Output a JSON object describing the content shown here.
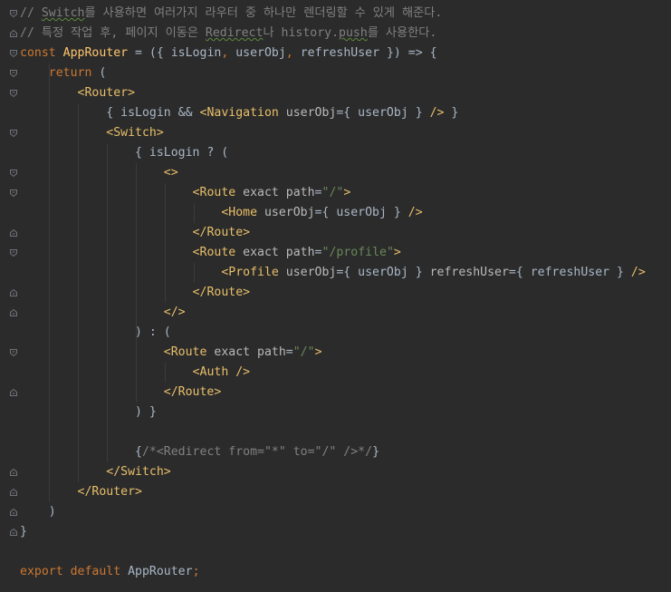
{
  "editor": {
    "background": "#2b2b2b",
    "colors": {
      "keyword": "#cc7832",
      "tag": "#e8bf6a",
      "attribute": "#bababa",
      "string": "#6a8759",
      "comment": "#808080",
      "function": "#ffc66d",
      "text": "#a9b7c6"
    },
    "lines": [
      {
        "tokens": [
          {
            "type": "c",
            "text": "// "
          },
          {
            "type": "c",
            "text": "Switch",
            "squiggle": true
          },
          {
            "type": "c",
            "text": "를 사용하면 여러가지 라우터 중 하나만 렌더링할 수 있게 해준다."
          }
        ]
      },
      {
        "tokens": [
          {
            "type": "c",
            "text": "// 특정 작업 후, 페이지 이동은 "
          },
          {
            "type": "c",
            "text": "Redirect",
            "squiggle": true
          },
          {
            "type": "c",
            "text": "나 history."
          },
          {
            "type": "c",
            "text": "push",
            "squiggle": true
          },
          {
            "type": "c",
            "text": "를 사용한다."
          }
        ]
      },
      {
        "tokens": [
          {
            "type": "k",
            "text": "const "
          },
          {
            "type": "f",
            "text": "AppRouter"
          },
          {
            "type": "p",
            "text": " = ({ isLogin"
          },
          {
            "type": "k",
            "text": ", "
          },
          {
            "type": "p",
            "text": "userObj"
          },
          {
            "type": "k",
            "text": ", "
          },
          {
            "type": "p",
            "text": "refreshUser }) => {"
          }
        ]
      },
      {
        "tokens": [
          {
            "type": "p",
            "text": "    "
          },
          {
            "type": "k",
            "text": "return "
          },
          {
            "type": "p",
            "text": "("
          }
        ]
      },
      {
        "tokens": [
          {
            "type": "p",
            "text": "        "
          },
          {
            "type": "t",
            "text": "<Router>"
          }
        ]
      },
      {
        "tokens": [
          {
            "type": "p",
            "text": "            { isLogin && "
          },
          {
            "type": "t",
            "text": "<Navigation "
          },
          {
            "type": "a",
            "text": "userObj"
          },
          {
            "type": "p",
            "text": "={ userObj } "
          },
          {
            "type": "t",
            "text": "/>"
          },
          {
            "type": "p",
            "text": " }"
          }
        ]
      },
      {
        "tokens": [
          {
            "type": "p",
            "text": "            "
          },
          {
            "type": "t",
            "text": "<Switch>"
          }
        ]
      },
      {
        "tokens": [
          {
            "type": "p",
            "text": "                { isLogin ? ("
          }
        ]
      },
      {
        "tokens": [
          {
            "type": "p",
            "text": "                    "
          },
          {
            "type": "t",
            "text": "<>"
          }
        ]
      },
      {
        "tokens": [
          {
            "type": "p",
            "text": "                        "
          },
          {
            "type": "t",
            "text": "<Route "
          },
          {
            "type": "a",
            "text": "exact path"
          },
          {
            "type": "p",
            "text": "="
          },
          {
            "type": "s",
            "text": "\"/\""
          },
          {
            "type": "t",
            "text": ">"
          }
        ]
      },
      {
        "tokens": [
          {
            "type": "p",
            "text": "                            "
          },
          {
            "type": "t",
            "text": "<Home "
          },
          {
            "type": "a",
            "text": "userObj"
          },
          {
            "type": "p",
            "text": "={ userObj } "
          },
          {
            "type": "t",
            "text": "/>"
          }
        ]
      },
      {
        "tokens": [
          {
            "type": "p",
            "text": "                        "
          },
          {
            "type": "t",
            "text": "</Route>"
          }
        ]
      },
      {
        "tokens": [
          {
            "type": "p",
            "text": "                        "
          },
          {
            "type": "t",
            "text": "<Route "
          },
          {
            "type": "a",
            "text": "exact path"
          },
          {
            "type": "p",
            "text": "="
          },
          {
            "type": "s",
            "text": "\"/profile\""
          },
          {
            "type": "t",
            "text": ">"
          }
        ]
      },
      {
        "tokens": [
          {
            "type": "p",
            "text": "                            "
          },
          {
            "type": "t",
            "text": "<Profile "
          },
          {
            "type": "a",
            "text": "userObj"
          },
          {
            "type": "p",
            "text": "={ userObj } "
          },
          {
            "type": "a",
            "text": "refreshUser"
          },
          {
            "type": "p",
            "text": "={ refreshUser } "
          },
          {
            "type": "t",
            "text": "/>"
          }
        ]
      },
      {
        "tokens": [
          {
            "type": "p",
            "text": "                        "
          },
          {
            "type": "t",
            "text": "</Route>"
          }
        ]
      },
      {
        "tokens": [
          {
            "type": "p",
            "text": "                    "
          },
          {
            "type": "t",
            "text": "</>"
          }
        ]
      },
      {
        "tokens": [
          {
            "type": "p",
            "text": "                ) : ("
          }
        ]
      },
      {
        "tokens": [
          {
            "type": "p",
            "text": "                    "
          },
          {
            "type": "t",
            "text": "<Route "
          },
          {
            "type": "a",
            "text": "exact path"
          },
          {
            "type": "p",
            "text": "="
          },
          {
            "type": "s",
            "text": "\"/\""
          },
          {
            "type": "t",
            "text": ">"
          }
        ]
      },
      {
        "tokens": [
          {
            "type": "p",
            "text": "                        "
          },
          {
            "type": "t",
            "text": "<Auth />"
          }
        ]
      },
      {
        "tokens": [
          {
            "type": "p",
            "text": "                    "
          },
          {
            "type": "t",
            "text": "</Route>"
          }
        ]
      },
      {
        "tokens": [
          {
            "type": "p",
            "text": "                ) }"
          }
        ]
      },
      {
        "tokens": []
      },
      {
        "tokens": [
          {
            "type": "p",
            "text": "                {"
          },
          {
            "type": "c",
            "text": "/*<Redirect from=\"*\" to=\"/\" />*/"
          },
          {
            "type": "p",
            "text": "}"
          }
        ]
      },
      {
        "tokens": [
          {
            "type": "p",
            "text": "            "
          },
          {
            "type": "t",
            "text": "</Switch>"
          }
        ]
      },
      {
        "tokens": [
          {
            "type": "p",
            "text": "        "
          },
          {
            "type": "t",
            "text": "</Router>"
          }
        ]
      },
      {
        "tokens": [
          {
            "type": "p",
            "text": "    )"
          }
        ]
      },
      {
        "tokens": [
          {
            "type": "p",
            "text": "}"
          }
        ]
      },
      {
        "tokens": []
      },
      {
        "tokens": [
          {
            "type": "k",
            "text": "export default "
          },
          {
            "type": "p",
            "text": "AppRouter"
          },
          {
            "type": "k",
            "text": ";"
          }
        ]
      }
    ]
  }
}
